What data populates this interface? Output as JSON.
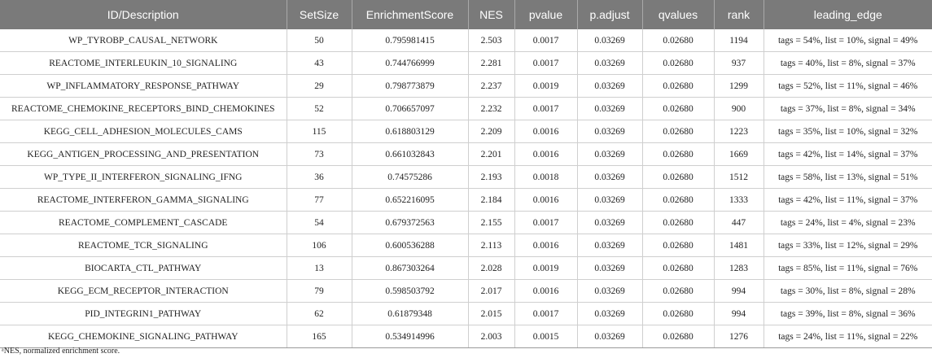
{
  "table": {
    "headers": [
      "ID/Description",
      "SetSize",
      "EnrichmentScore",
      "NES",
      "pvalue",
      "p.adjust",
      "qvalues",
      "rank",
      "leading_edge"
    ],
    "rows": [
      [
        "WP_TYROBP_CAUSAL_NETWORK",
        "50",
        "0.795981415",
        "2.503",
        "0.0017",
        "0.03269",
        "0.02680",
        "1194",
        "tags = 54%, list = 10%, signal = 49%"
      ],
      [
        "REACTOME_INTERLEUKIN_10_SIGNALING",
        "43",
        "0.744766999",
        "2.281",
        "0.0017",
        "0.03269",
        "0.02680",
        "937",
        "tags = 40%, list = 8%, signal = 37%"
      ],
      [
        "WP_INFLAMMATORY_RESPONSE_PATHWAY",
        "29",
        "0.798773879",
        "2.237",
        "0.0019",
        "0.03269",
        "0.02680",
        "1299",
        "tags = 52%, list = 11%, signal = 46%"
      ],
      [
        "REACTOME_CHEMOKINE_RECEPTORS_BIND_CHEMOKINES",
        "52",
        "0.706657097",
        "2.232",
        "0.0017",
        "0.03269",
        "0.02680",
        "900",
        "tags = 37%, list = 8%, signal = 34%"
      ],
      [
        "KEGG_CELL_ADHESION_MOLECULES_CAMS",
        "115",
        "0.618803129",
        "2.209",
        "0.0016",
        "0.03269",
        "0.02680",
        "1223",
        "tags = 35%, list = 10%, signal = 32%"
      ],
      [
        "KEGG_ANTIGEN_PROCESSING_AND_PRESENTATION",
        "73",
        "0.661032843",
        "2.201",
        "0.0016",
        "0.03269",
        "0.02680",
        "1669",
        "tags = 42%, list = 14%, signal = 37%"
      ],
      [
        "WP_TYPE_II_INTERFERON_SIGNALING_IFNG",
        "36",
        "0.74575286",
        "2.193",
        "0.0018",
        "0.03269",
        "0.02680",
        "1512",
        "tags = 58%, list = 13%, signal = 51%"
      ],
      [
        "REACTOME_INTERFERON_GAMMA_SIGNALING",
        "77",
        "0.652216095",
        "2.184",
        "0.0016",
        "0.03269",
        "0.02680",
        "1333",
        "tags = 42%, list = 11%, signal = 37%"
      ],
      [
        "REACTOME_COMPLEMENT_CASCADE",
        "54",
        "0.679372563",
        "2.155",
        "0.0017",
        "0.03269",
        "0.02680",
        "447",
        "tags = 24%, list = 4%, signal = 23%"
      ],
      [
        "REACTOME_TCR_SIGNALING",
        "106",
        "0.600536288",
        "2.113",
        "0.0016",
        "0.03269",
        "0.02680",
        "1481",
        "tags = 33%, list = 12%, signal = 29%"
      ],
      [
        "BIOCARTA_CTL_PATHWAY",
        "13",
        "0.867303264",
        "2.028",
        "0.0019",
        "0.03269",
        "0.02680",
        "1283",
        "tags = 85%, list = 11%, signal = 76%"
      ],
      [
        "KEGG_ECM_RECEPTOR_INTERACTION",
        "79",
        "0.598503792",
        "2.017",
        "0.0016",
        "0.03269",
        "0.02680",
        "994",
        "tags = 30%, list = 8%, signal = 28%"
      ],
      [
        "PID_INTEGRIN1_PATHWAY",
        "62",
        "0.61879348",
        "2.015",
        "0.0017",
        "0.03269",
        "0.02680",
        "994",
        "tags = 39%, list = 8%, signal = 36%"
      ],
      [
        "KEGG_CHEMOKINE_SIGNALING_PATHWAY",
        "165",
        "0.534914996",
        "2.003",
        "0.0015",
        "0.03269",
        "0.02680",
        "1276",
        "tags = 24%, list = 11%, signal = 22%"
      ]
    ]
  },
  "footnote": "ᵃNES, normalized enrichment score.",
  "colors": {
    "header_bg": "#7a7a7a",
    "header_text": "#ffffff",
    "grid": "#cfcfcf"
  }
}
